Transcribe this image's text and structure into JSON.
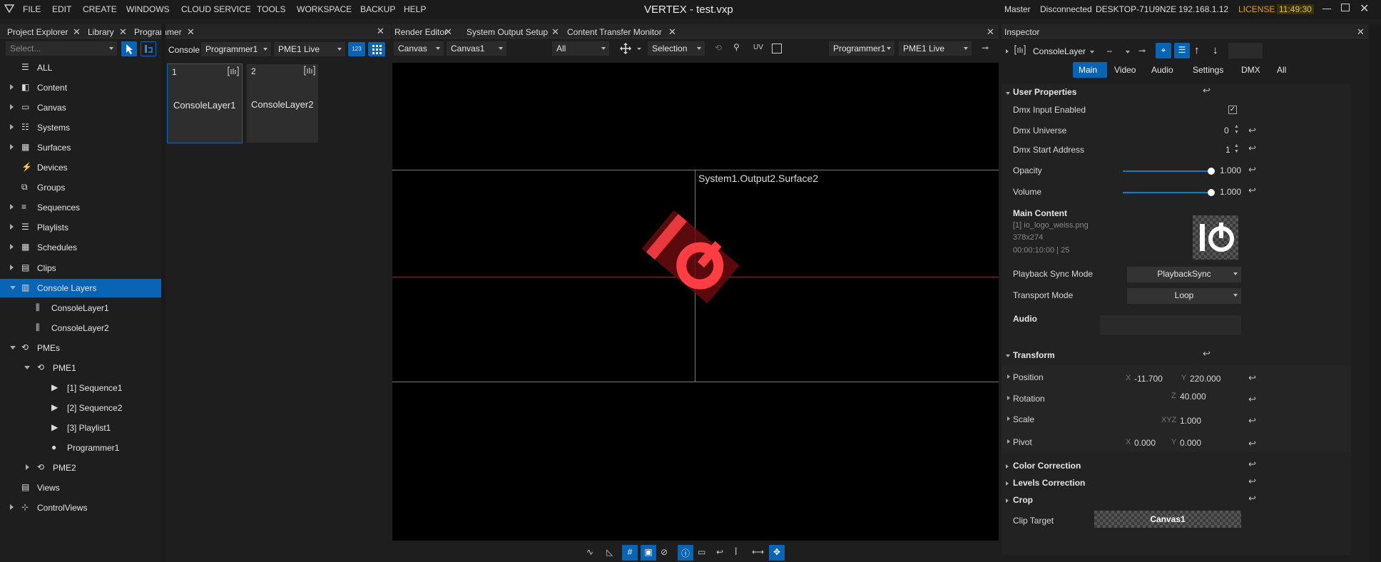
{
  "app": {
    "title": "VERTEX - test.vxp",
    "menu": [
      "FILE",
      "EDIT",
      "CREATE",
      "WINDOWS",
      "CLOUD SERVICE",
      "TOOLS",
      "WORKSPACE",
      "BACKUP",
      "HELP"
    ],
    "status": {
      "role": "Master",
      "connection": "Disconnected",
      "host": "DESKTOP-71U9N2E",
      "ip": "192.168.1.12",
      "license": "LICENSE",
      "time": "11:49:30"
    }
  },
  "left_tabs": [
    "Project Explorer",
    "Library",
    "Programmer"
  ],
  "explorer": {
    "select_placeholder": "Select...",
    "items": [
      {
        "label": "ALL",
        "icon": "database-icon",
        "expand": false
      },
      {
        "label": "Content",
        "icon": "content-icon",
        "expand": true
      },
      {
        "label": "Canvas",
        "icon": "canvas-icon",
        "expand": true
      },
      {
        "label": "Systems",
        "icon": "systems-icon",
        "expand": true
      },
      {
        "label": "Surfaces",
        "icon": "surfaces-icon",
        "expand": true
      },
      {
        "label": "Devices",
        "icon": "plug-icon",
        "expand": false
      },
      {
        "label": "Groups",
        "icon": "groups-icon",
        "expand": false
      },
      {
        "label": "Sequences",
        "icon": "sequences-icon",
        "expand": true
      },
      {
        "label": "Playlists",
        "icon": "playlists-icon",
        "expand": true
      },
      {
        "label": "Schedules",
        "icon": "calendar-icon",
        "expand": true
      },
      {
        "label": "Clips",
        "icon": "clips-icon",
        "expand": true
      },
      {
        "label": "Console Layers",
        "icon": "console-layers-icon",
        "expand": true,
        "selected": true
      },
      {
        "label": "ConsoleLayer1",
        "icon": "layer-icon",
        "indent": 1
      },
      {
        "label": "ConsoleLayer2",
        "icon": "layer-icon",
        "indent": 1
      },
      {
        "label": "PMEs",
        "icon": "pme-icon",
        "expand": true
      },
      {
        "label": "PME1",
        "icon": "pme-icon",
        "indent": 1
      },
      {
        "label": "[1] Sequence1",
        "icon": "play-icon",
        "indent": 2
      },
      {
        "label": "[2] Sequence2",
        "icon": "play-icon",
        "indent": 2
      },
      {
        "label": "[3] Playlist1",
        "icon": "play-icon",
        "indent": 2
      },
      {
        "label": "Programmer1",
        "icon": "programmer-icon",
        "indent": 2
      },
      {
        "label": "PME2",
        "icon": "pme-icon",
        "indent": 1
      },
      {
        "label": "Views",
        "icon": "views-icon",
        "expand": false
      },
      {
        "label": "ControlViews",
        "icon": "controlviews-icon",
        "expand": true
      }
    ]
  },
  "console": {
    "label": "Console",
    "programmer": "Programmer1",
    "pme": "PME1 Live",
    "btn_num": "123",
    "tiles": [
      {
        "num": "1",
        "name": "ConsoleLayer1"
      },
      {
        "num": "2",
        "name": "ConsoleLayer2"
      }
    ]
  },
  "center_tabs": [
    "Render Editor",
    "System Output Setup",
    "Content Transfer Monitor"
  ],
  "render": {
    "mode": "Canvas",
    "canvas": "Canvas1",
    "filter": "All",
    "tool": "Selection",
    "programmer": "Programmer1",
    "pme": "PME1 Live",
    "surface_label": "System1.Output2.Surface2"
  },
  "inspector": {
    "tab": "Inspector",
    "object": "ConsoleLayer",
    "dash": "–",
    "tabs": [
      "Main",
      "Video",
      "Audio",
      "Settings",
      "DMX",
      "All"
    ],
    "user_props": "User Properties",
    "dmx_input": "Dmx Input Enabled",
    "dmx_universe": "Dmx Universe",
    "dmx_universe_val": "0",
    "dmx_start": "Dmx Start Address",
    "dmx_start_val": "1",
    "opacity": "Opacity",
    "opacity_val": "1.000",
    "opacity_level": 1.0,
    "volume": "Volume",
    "volume_val": "1.000",
    "volume_level": 1.0,
    "main_content": "Main Content",
    "file": "[1] io_logo_weiss.png",
    "dims": "378x274",
    "duration": "00:00:10:00 | 25",
    "sync_label": "Playback Sync Mode",
    "sync_val": "PlaybackSync",
    "transport_label": "Transport Mode",
    "transport_val": "Loop",
    "audio": "Audio",
    "transform": "Transform",
    "position": "Position",
    "pos_x_lbl": "X",
    "pos_x": "-11.700",
    "pos_y_lbl": "Y",
    "pos_y": "220.000",
    "rotation": "Rotation",
    "rot_lbl": "Z",
    "rot_z": "40.000",
    "scale": "Scale",
    "scale_lbl": "XYZ",
    "scale_val": "1.000",
    "pivot": "Pivot",
    "piv_x_lbl": "X",
    "piv_x": "0.000",
    "piv_y_lbl": "Y",
    "piv_y": "0.000",
    "color_corr": "Color Correction",
    "levels_corr": "Levels Correction",
    "crop": "Crop",
    "clip_target": "Clip Target",
    "clip_target_val": "Canvas1"
  }
}
